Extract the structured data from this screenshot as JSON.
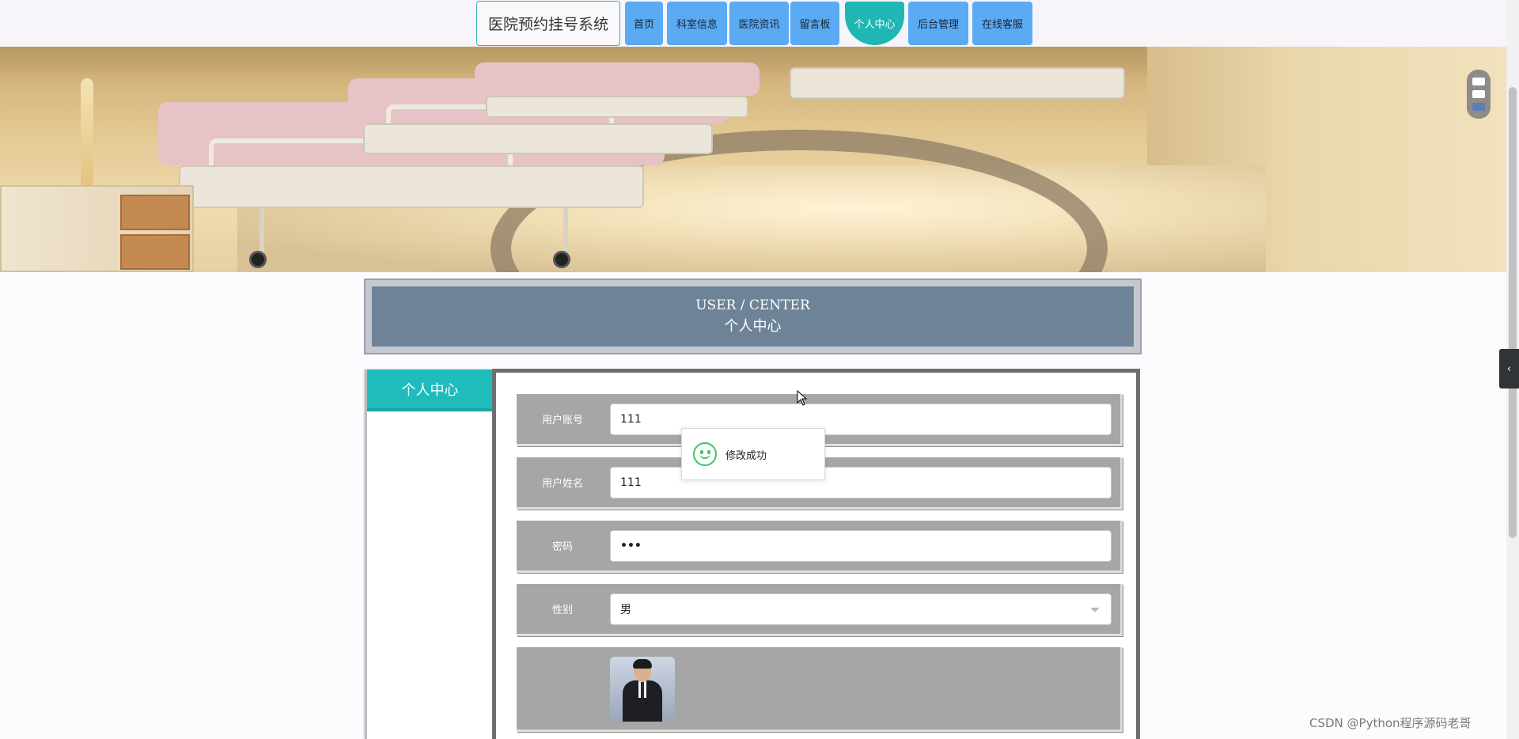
{
  "header": {
    "brand": "医院预约挂号系统",
    "nav": [
      {
        "label": "首页"
      },
      {
        "label": "科室信息"
      },
      {
        "label": "医院资讯"
      },
      {
        "label": "留言板"
      },
      {
        "label": "个人中心",
        "active": true
      },
      {
        "label": "后台管理"
      },
      {
        "label": "在线客服"
      }
    ]
  },
  "carousel": {
    "slides": 3,
    "active_index": 2
  },
  "title_panel": {
    "en": "USER / CENTER",
    "cn": "个人中心"
  },
  "side_menu": {
    "items": [
      {
        "label": "个人中心"
      }
    ]
  },
  "form": {
    "username": {
      "label": "用户账号",
      "value": "111"
    },
    "name": {
      "label": "用户姓名",
      "value": "111"
    },
    "password": {
      "label": "密码",
      "value": "•••"
    },
    "gender": {
      "label": "性别",
      "value": "男",
      "type": "select"
    },
    "avatar": {
      "label": "",
      "icon": "avatar-photo"
    }
  },
  "toast": {
    "message": "修改成功",
    "icon": "smile-icon"
  },
  "sidebar_toggle": {
    "icon": "chevron-left-icon",
    "glyph": "‹"
  },
  "watermark": "CSDN @Python程序源码老哥",
  "colors": {
    "nav_button": "#5aaaf4",
    "nav_active": "#1fb6b4",
    "title_panel": "#6e8398",
    "side_menu_active": "#1fbcbc",
    "form_row": "#a6a6a6",
    "toast_icon": "#3fc36b"
  }
}
